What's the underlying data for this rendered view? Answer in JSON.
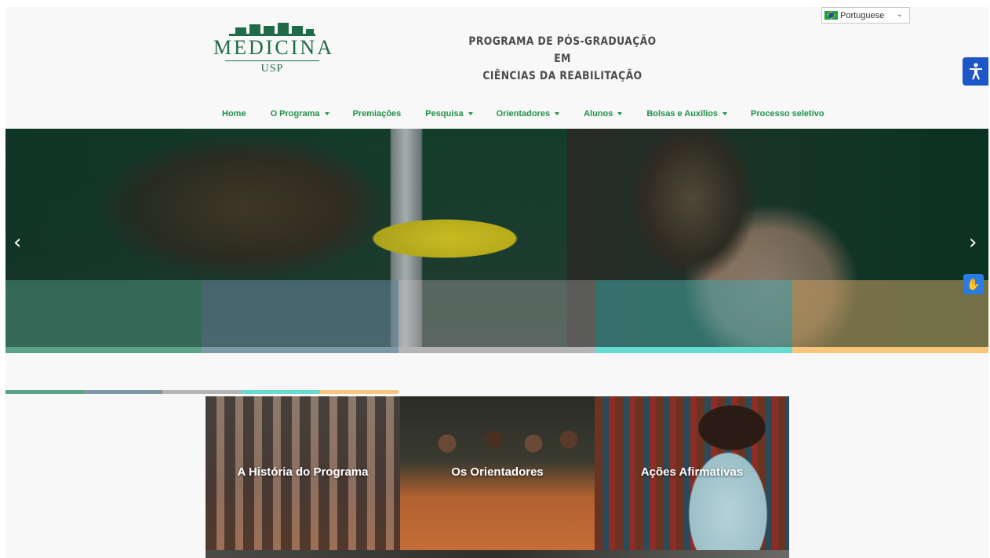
{
  "header": {
    "logo": {
      "word": "MEDICINA",
      "sub": "USP"
    },
    "program_title_line1": "PROGRAMA DE PÓS-GRADUAÇÃO EM",
    "program_title_line2": "CIÊNCIAS DA REABILITAÇÃO",
    "language": {
      "selected": "Portuguese",
      "flag": "brazil-flag-icon"
    }
  },
  "nav": {
    "items": [
      {
        "label": "Home",
        "dropdown": false
      },
      {
        "label": "O Programa",
        "dropdown": true
      },
      {
        "label": "Premiações",
        "dropdown": false
      },
      {
        "label": "Pesquisa",
        "dropdown": true
      },
      {
        "label": "Orientadores",
        "dropdown": true
      },
      {
        "label": "Alunos",
        "dropdown": true
      },
      {
        "label": "Bolsas e Auxílios",
        "dropdown": true
      },
      {
        "label": "Processo seletivo",
        "dropdown": false
      }
    ]
  },
  "hero": {
    "prev_icon": "chevron-left-icon",
    "next_icon": "chevron-right-icon",
    "stripe_colors": [
      "#5aa386",
      "#7d99a8",
      "#b4b4b4",
      "#66dcd0",
      "#f7c57b"
    ]
  },
  "cards": [
    {
      "label": "A História do Programa"
    },
    {
      "label": "Os Orientadores"
    },
    {
      "label": "Ações Afirmativas"
    }
  ],
  "colors": {
    "brand_green": "#1f6b47",
    "nav_green": "#1f9248",
    "accessibility_blue": "#1d56c9"
  }
}
